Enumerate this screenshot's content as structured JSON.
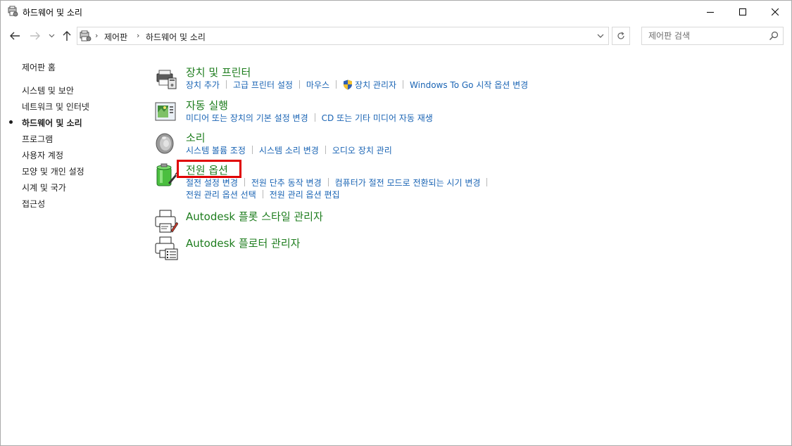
{
  "window": {
    "title": "하드웨어 및 소리"
  },
  "address": {
    "crumbs": [
      "제어판",
      "하드웨어 및 소리"
    ]
  },
  "search": {
    "placeholder": "제어판 검색"
  },
  "sidebar": {
    "home": "제어판 홈",
    "items": [
      {
        "label": "시스템 및 보안"
      },
      {
        "label": "네트워크 및 인터넷"
      },
      {
        "label": "하드웨어 및 소리",
        "current": true
      },
      {
        "label": "프로그램"
      },
      {
        "label": "사용자 계정"
      },
      {
        "label": "모양 및 개인 설정"
      },
      {
        "label": "시계 및 국가"
      },
      {
        "label": "접근성"
      }
    ]
  },
  "categories": [
    {
      "title": "장치 및 프린터",
      "icon": "devices-printers-icon",
      "links": [
        "장치 추가",
        "고급 프린터 설정",
        "마우스",
        "장치 관리자",
        "Windows To Go 시작 옵션 변경"
      ]
    },
    {
      "title": "자동 실행",
      "icon": "autoplay-icon",
      "links": [
        "미디어 또는 장치의 기본 설정 변경",
        "CD 또는 기타 미디어 자동 재생"
      ]
    },
    {
      "title": "소리",
      "icon": "speaker-icon",
      "links": [
        "시스템 볼륨 조정",
        "시스템 소리 변경",
        "오디오 장치 관리"
      ]
    },
    {
      "title": "전원 옵션",
      "icon": "power-options-icon",
      "links": [
        "절전 설정 변경",
        "전원 단추 동작 변경",
        "컴퓨터가 절전 모드로 전환되는 시기 변경",
        "전원 관리 옵션 선택",
        "전원 관리 옵션 편집"
      ],
      "highlighted": true
    },
    {
      "title": "Autodesk 플롯 스타일 관리자",
      "icon": "plot-style-manager-icon",
      "links": []
    },
    {
      "title": "Autodesk 플로터 관리자",
      "icon": "plotter-manager-icon",
      "links": []
    }
  ],
  "colors": {
    "category_title": "#1e7d1e",
    "link": "#1a64b4",
    "highlight": "#e00000"
  }
}
